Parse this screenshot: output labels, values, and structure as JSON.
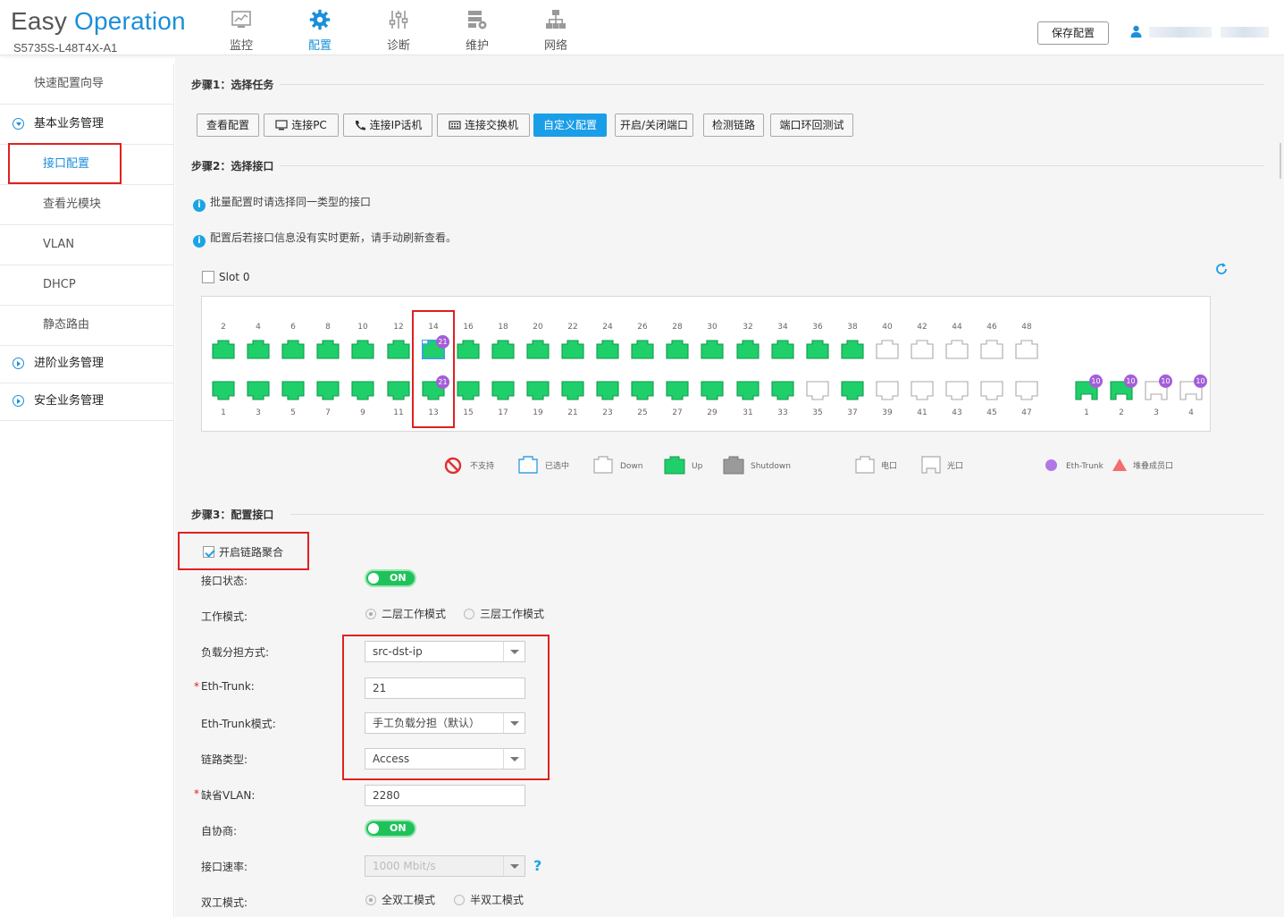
{
  "header": {
    "logo_part1": "Easy ",
    "logo_part2": "Operation",
    "model": "S5735S-L48T4X-A1",
    "nav": [
      {
        "label": "监控",
        "icon": "monitor-icon"
      },
      {
        "label": "配置",
        "icon": "gear-icon"
      },
      {
        "label": "诊断",
        "icon": "sliders-icon"
      },
      {
        "label": "维护",
        "icon": "server-gear-icon"
      },
      {
        "label": "网络",
        "icon": "network-icon"
      }
    ],
    "save_label": "保存配置"
  },
  "sidebar": {
    "items": [
      {
        "label": "快速配置向导"
      },
      {
        "label": "基本业务管理"
      },
      {
        "label": "接口配置"
      },
      {
        "label": "查看光模块"
      },
      {
        "label": "VLAN"
      },
      {
        "label": "DHCP"
      },
      {
        "label": "静态路由"
      },
      {
        "label": "进阶业务管理"
      },
      {
        "label": "安全业务管理"
      }
    ]
  },
  "step1": {
    "title": "步骤1：选择任务",
    "tasks": [
      "查看配置",
      "连接PC",
      "连接IP话机",
      "连接交换机",
      "自定义配置",
      "开启/关闭端口",
      "检测链路",
      "端口环回测试"
    ],
    "active_task": "自定义配置"
  },
  "step2": {
    "title": "步骤2：选择接口",
    "info1": "批量配置时请选择同一类型的接口",
    "info2": "配置后若接口信息没有实时更新，请手动刷新查看。",
    "slot_label": "Slot 0",
    "top_numbers": [
      "2",
      "4",
      "6",
      "8",
      "10",
      "12",
      "14",
      "16",
      "18",
      "20",
      "22",
      "24",
      "26",
      "28",
      "30",
      "32",
      "34",
      "36",
      "38",
      "40",
      "42",
      "44",
      "46",
      "48"
    ],
    "bottom_numbers": [
      "1",
      "3",
      "5",
      "7",
      "9",
      "11",
      "13",
      "15",
      "17",
      "19",
      "21",
      "23",
      "25",
      "27",
      "29",
      "31",
      "33",
      "35",
      "37",
      "39",
      "41",
      "43",
      "45",
      "47"
    ],
    "top_status": [
      "up",
      "up",
      "up",
      "up",
      "up",
      "up",
      "selected",
      "up",
      "up",
      "up",
      "up",
      "up",
      "up",
      "up",
      "up",
      "up",
      "up",
      "up",
      "up",
      "down",
      "down",
      "down",
      "down",
      "down"
    ],
    "bottom_status": [
      "up",
      "up",
      "up",
      "up",
      "up",
      "up",
      "up",
      "up",
      "up",
      "up",
      "up",
      "up",
      "up",
      "up",
      "up",
      "up",
      "up",
      "down",
      "up",
      "down",
      "down",
      "down",
      "down",
      "down"
    ],
    "badge_top_14": "21",
    "badge_bottom_13": "21",
    "fiber_numbers": [
      "1",
      "2",
      "3",
      "4"
    ],
    "fiber_status": [
      "up",
      "up",
      "down",
      "down"
    ],
    "fiber_badges": [
      "10",
      "10",
      "10",
      "10"
    ],
    "legend": {
      "unsupported": "不支持",
      "selected": "已选中",
      "down": "Down",
      "up": "Up",
      "shutdown": "Shutdown",
      "copper": "电口",
      "fiber": "光口",
      "eth_trunk": "Eth-Trunk",
      "stack_member": "堆叠成员口"
    },
    "colors": {
      "up": "#1fcf6a",
      "selected_border": "#3aa0e6",
      "badge": "#a45ed8",
      "accent": "#1a9ee8"
    }
  },
  "step3": {
    "title": "步骤3：配置接口",
    "link_agg_label": "开启链路聚合",
    "link_agg_checked": true,
    "port_status_label": "接口状态:",
    "port_status_value": "ON",
    "work_mode_label": "工作模式:",
    "work_mode_l2": "二层工作模式",
    "work_mode_l3": "三层工作模式",
    "load_balance_label": "负载分担方式:",
    "load_balance_value": "src-dst-ip",
    "eth_trunk_label": "Eth-Trunk:",
    "eth_trunk_value": "21",
    "eth_trunk_mode_label": "Eth-Trunk模式:",
    "eth_trunk_mode_value": "手工负载分担（默认）",
    "link_type_label": "链路类型:",
    "link_type_value": "Access",
    "default_vlan_label": "缺省VLAN:",
    "default_vlan_value": "2280",
    "autoneg_label": "自协商:",
    "autoneg_value": "ON",
    "speed_label": "接口速率:",
    "speed_value": "1000 Mbit/s",
    "duplex_label": "双工模式:",
    "duplex_full": "全双工模式",
    "duplex_half": "半双工模式"
  }
}
